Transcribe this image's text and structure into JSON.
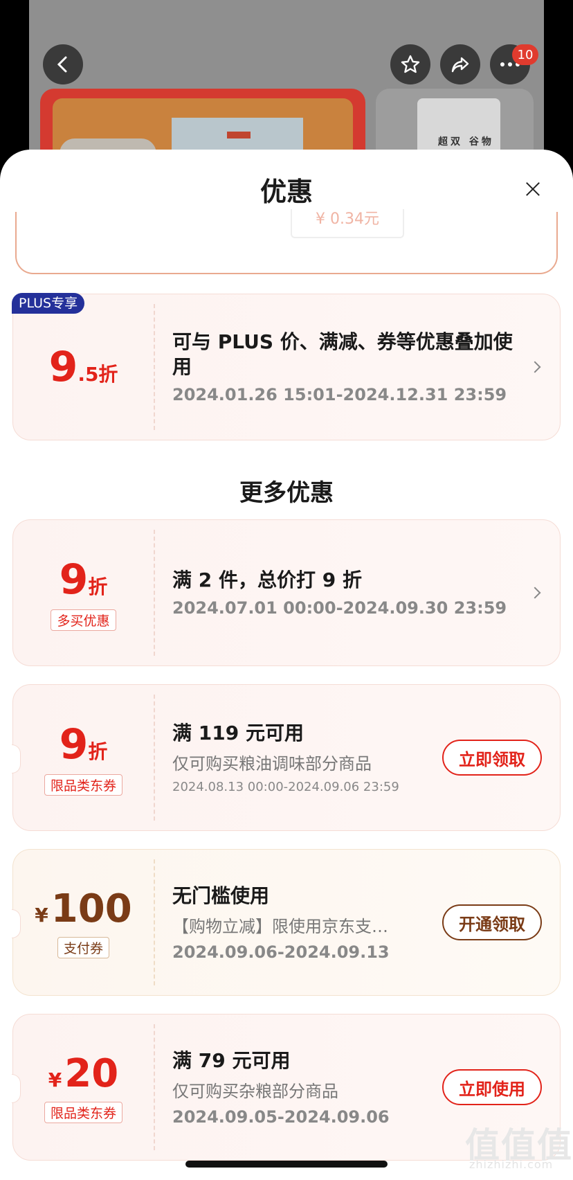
{
  "header": {
    "notification_count": "10",
    "pack_label": "超双 谷物"
  },
  "sheet": {
    "title": "优惠",
    "prev_pill": "¥ 0.34元"
  },
  "plus_coupon": {
    "badge": "PLUS专享",
    "discount_num": "9",
    "discount_unit": ".5折",
    "title": "可与 PLUS 价、满减、券等优惠叠加使用",
    "date": "2024.01.26 15:01-2024.12.31 23:59"
  },
  "more_section": {
    "title": "更多优惠"
  },
  "coupons": [
    {
      "discount_num": "9",
      "discount_unit": "折",
      "tag": "多买优惠",
      "title": "满 2 件，总价打 9 折",
      "date": "2024.07.01 00:00-2024.09.30 23:59"
    },
    {
      "discount_num": "9",
      "discount_unit": "折",
      "tag": "限品类东券",
      "title": "满 119 元可用",
      "subtitle": "仅可购买粮油调味部分商品",
      "date": "2024.08.13 00:00-2024.09.06 23:59",
      "action": "立即领取"
    },
    {
      "currency": "¥",
      "amount": "100",
      "tag": "支付券",
      "title": "无门槛使用",
      "subtitle": "【购物立减】限使用京东支…",
      "date": "2024.09.06-2024.09.13",
      "action": "开通领取"
    },
    {
      "currency": "¥",
      "amount": "20",
      "tag": "限品类东券",
      "title": "满 79 元可用",
      "subtitle": "仅可购买杂粮部分商品",
      "date": "2024.09.05-2024.09.06",
      "action": "立即使用"
    }
  ],
  "watermark": {
    "main": "值值值",
    "sub": "zhizhizhi.com"
  },
  "colors": {
    "accent_red": "#e2231a",
    "plus_blue": "#24309a",
    "gold_brown": "#7a3b16"
  }
}
